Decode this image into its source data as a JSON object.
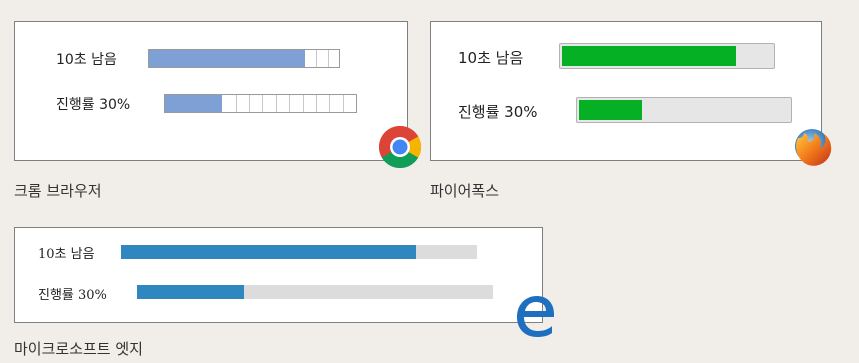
{
  "panels": {
    "chrome": {
      "caption": "크롬 브라우저",
      "row1_label": "10초 남음",
      "row1_progress": 0.82,
      "row2_label": "진행률 30%",
      "row2_progress": 0.3,
      "icon": "chrome-logo-icon"
    },
    "firefox": {
      "caption": "파이어폭스",
      "row1_label": "10초 남음",
      "row1_progress": 0.83,
      "row2_label": "진행률 30%",
      "row2_progress": 0.3,
      "icon": "firefox-logo-icon"
    },
    "edge": {
      "caption": "마이크로소프트 엣지",
      "row1_label": "10초 남음",
      "row1_progress": 0.83,
      "row2_label": "진행률 30%",
      "row2_progress": 0.3,
      "icon": "edge-logo-icon"
    }
  },
  "colors": {
    "chrome_fill": "#7ea0d4",
    "firefox_fill": "#06b025",
    "edge_fill": "#3087bf",
    "background": "#f1eeea"
  }
}
